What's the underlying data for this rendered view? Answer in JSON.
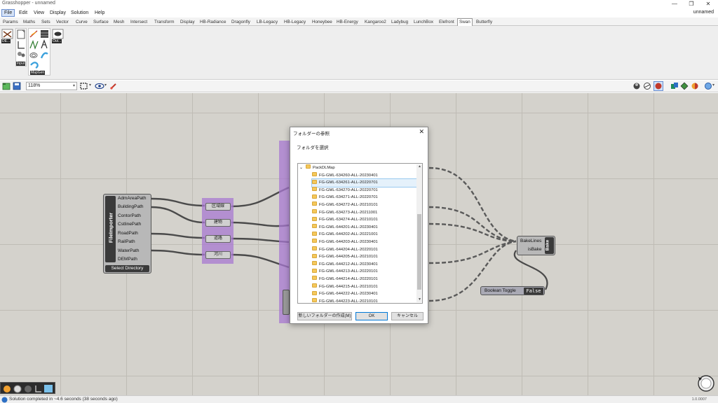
{
  "window": {
    "title": "Grasshopper - unnamed",
    "minimize": "—",
    "restore": "❐",
    "close": "✕"
  },
  "menu": [
    "File",
    "Edit",
    "View",
    "Display",
    "Solution",
    "Help"
  ],
  "user": "unnamed",
  "tabs": [
    "Params",
    "Maths",
    "Sets",
    "Vector",
    "Curve",
    "Surface",
    "Mesh",
    "Intersect",
    "Transform",
    "Display",
    "HB-Radiance",
    "Dragonfly",
    "LB-Legacy",
    "HB-Legacy",
    "Honeybee",
    "HB-Energy",
    "Kangaroo2",
    "Ladybug",
    "LunchBox",
    "Elefront",
    "Swan",
    "Butterfly"
  ],
  "active_tab": "Swan",
  "ribbon": {
    "labels": {
      "de": "DE...",
      "input": "Input",
      "mapgen": "MapGen",
      "out": "Out..."
    }
  },
  "toolbar": {
    "zoom": "118%"
  },
  "canvas": {
    "file_importer": {
      "title": "FileImporter",
      "outputs": [
        "AdmAreaPath",
        "BuildingPath",
        "ContorPath",
        "CstlinePath",
        "RoadPath",
        "RailPath",
        "WaterPath",
        "DEMPath"
      ],
      "button": "Select Directory"
    },
    "params": [
      "区域線",
      "建物",
      "道路",
      "河川"
    ],
    "bake": {
      "inputs": [
        "BakeLines",
        "isBake"
      ],
      "title": "Bake"
    },
    "toggle": {
      "label": "Boolean Toggle",
      "value": "False"
    }
  },
  "dialog": {
    "title": "フォルダーの参照",
    "prompt": "フォルダを選択",
    "root": "PackDLMap",
    "folders": [
      "FG-GML-634260-ALL-20230401",
      "FG-GML-634261-ALL-20220701",
      "FG-GML-634270-ALL-20220701",
      "FG-GML-634271-ALL-20220701",
      "FG-GML-634272-ALL-20210101",
      "FG-GML-634273-ALL-20211001",
      "FG-GML-634274-ALL-20210101",
      "FG-GML-644201-ALL-20230401",
      "FG-GML-644202-ALL-20221001",
      "FG-GML-644203-ALL-20230401",
      "FG-GML-644204-ALL-20220101",
      "FG-GML-644205-ALL-20210101",
      "FG-GML-644212-ALL-20230401",
      "FG-GML-644213-ALL-20220101",
      "FG-GML-644214-ALL-20220101",
      "FG-GML-644215-ALL-20210101",
      "FG-GML-644222-ALL-20230401",
      "FG-GML-644223-ALL-20210101"
    ],
    "selected_index": 1,
    "new_folder": "新しいフォルダーの作成(M)",
    "ok": "OK",
    "cancel": "キャンセル"
  },
  "status": {
    "message": "Solution completed in ~4.6 seconds (38 seconds ago)",
    "version": "1.0.0007"
  }
}
